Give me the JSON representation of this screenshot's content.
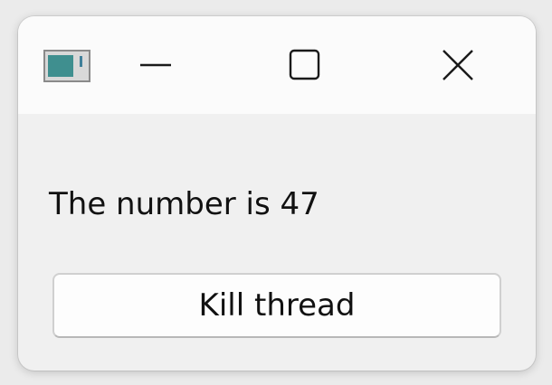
{
  "window": {
    "icon": "app-window-icon",
    "controls": {
      "minimize_icon": "minimize-icon",
      "maximize_icon": "maximize-icon",
      "close_icon": "close-icon"
    }
  },
  "content": {
    "message": "The number is 47",
    "kill_button_label": "Kill thread"
  },
  "colors": {
    "titlebar_bg": "#fbfbfb",
    "client_bg": "#f0f0f0",
    "text": "#111111"
  }
}
